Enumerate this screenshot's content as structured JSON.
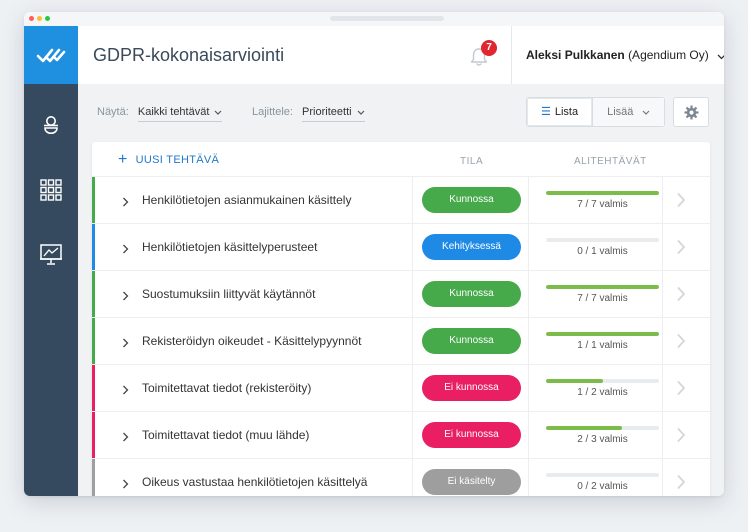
{
  "app": {
    "title": "GDPR-kokonaisarviointi",
    "notification_count": "7",
    "user_name": "Aleksi Pulkkanen",
    "user_org": "(Agendium Oy)"
  },
  "toolbar": {
    "show_label": "Näytä:",
    "show_value": "Kaikki tehtävät",
    "sort_label": "Lajittele:",
    "sort_value": "Prioriteetti",
    "view_list": "Lista",
    "view_more": "Lisää"
  },
  "table": {
    "new_task": "UUSI TEHTÄVÄ",
    "col_status": "TILA",
    "col_subtasks": "ALITEHTÄVÄT",
    "rows": [
      {
        "title": "Henkilötietojen asianmukainen käsittely",
        "status": "Kunnossa",
        "progress_text": "7 / 7 valmis",
        "progress": 1.0
      },
      {
        "title": "Henkilötietojen käsittelyperusteet",
        "status": "Kehityksessä",
        "progress_text": "0 / 1 valmis",
        "progress": 0.0
      },
      {
        "title": "Suostumuksiin liittyvät käytännöt",
        "status": "Kunnossa",
        "progress_text": "7 / 7 valmis",
        "progress": 1.0
      },
      {
        "title": "Rekisteröidyn oikeudet - Käsittelypyynnöt",
        "status": "Kunnossa",
        "progress_text": "1 / 1 valmis",
        "progress": 1.0
      },
      {
        "title": "Toimitettavat tiedot (rekisteröity)",
        "status": "Ei kunnossa",
        "progress_text": "1 / 2 valmis",
        "progress": 0.5
      },
      {
        "title": "Toimitettavat tiedot (muu lähde)",
        "status": "Ei kunnossa",
        "progress_text": "2 / 3 valmis",
        "progress": 0.667
      },
      {
        "title": "Oikeus vastustaa henkilötietojen käsittelyä",
        "status": "Ei käsitelty",
        "progress_text": "0 / 2 valmis",
        "progress": 0.0
      }
    ]
  },
  "colors": {
    "brand": "#1f8fe0",
    "sidebar": "#354a5e",
    "ok": "#46a94a",
    "in_progress": "#1e8ae6",
    "not_ok": "#e91e63",
    "not_handled": "#9e9e9e",
    "progress_fill": "#7cbc4a"
  }
}
